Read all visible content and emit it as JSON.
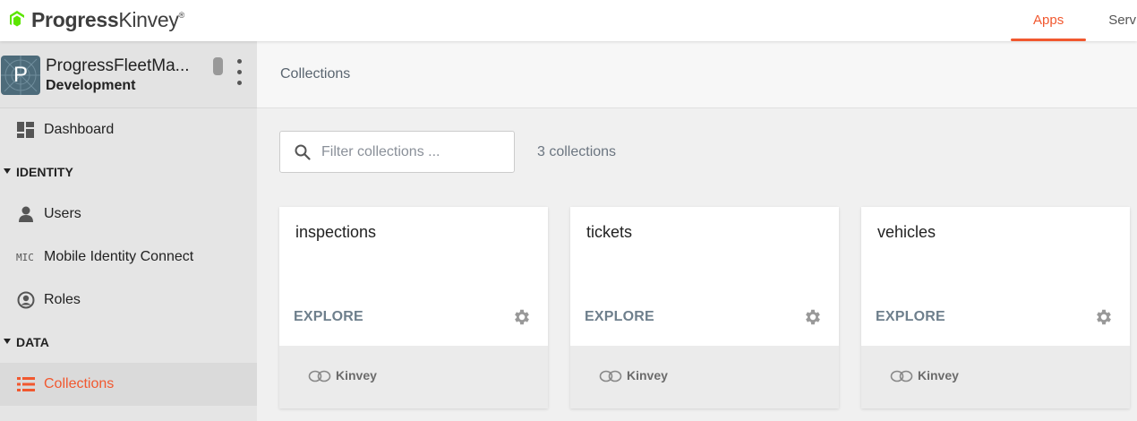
{
  "brand": {
    "name_bold": "Progress",
    "name_light": "Kinvey",
    "mark": "®",
    "accent": "#f1582f"
  },
  "topnav": {
    "tabs": [
      {
        "label": "Apps",
        "active": true
      },
      {
        "label": "Serv",
        "active": false
      }
    ]
  },
  "app": {
    "avatar_letter": "P",
    "name": "ProgressFleetMa...",
    "environment": "Development"
  },
  "sidebar": {
    "items": [
      {
        "type": "item",
        "label": "Dashboard",
        "icon": "dashboard-icon"
      },
      {
        "type": "section",
        "label": "IDENTITY"
      },
      {
        "type": "item",
        "label": "Users",
        "icon": "user-icon"
      },
      {
        "type": "item",
        "label": "Mobile Identity Connect",
        "icon": "mic-icon",
        "icon_text": "MIC"
      },
      {
        "type": "item",
        "label": "Roles",
        "icon": "roles-icon"
      },
      {
        "type": "section",
        "label": "DATA"
      },
      {
        "type": "item",
        "label": "Collections",
        "icon": "list-icon",
        "active": true
      }
    ]
  },
  "main": {
    "title": "Collections",
    "filter": {
      "placeholder": "Filter collections ...",
      "value": ""
    },
    "count_text": "3 collections",
    "cards": [
      {
        "title": "inspections",
        "action": "EXPLORE",
        "footer_label": "Kinvey"
      },
      {
        "title": "tickets",
        "action": "EXPLORE",
        "footer_label": "Kinvey"
      },
      {
        "title": "vehicles",
        "action": "EXPLORE",
        "footer_label": "Kinvey"
      }
    ]
  }
}
